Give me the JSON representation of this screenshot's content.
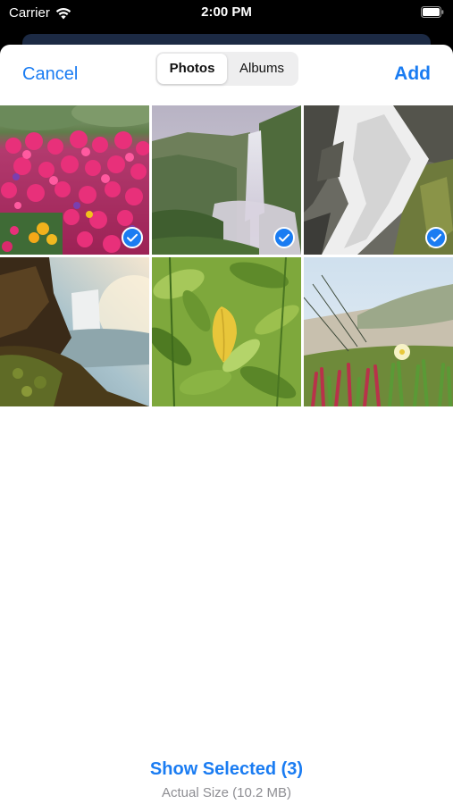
{
  "status_bar": {
    "carrier": "Carrier",
    "time": "2:00 PM"
  },
  "nav": {
    "cancel_label": "Cancel",
    "add_label": "Add",
    "tabs": [
      {
        "label": "Photos",
        "selected": true
      },
      {
        "label": "Albums",
        "selected": false
      }
    ]
  },
  "photos": [
    {
      "subject": "pink flowers",
      "selected": true
    },
    {
      "subject": "waterfall in green valley",
      "selected": true
    },
    {
      "subject": "long-exposure waterfall over rocks",
      "selected": true
    },
    {
      "subject": "waterfall and river at sunset",
      "selected": false
    },
    {
      "subject": "yellow leaf among green leaves",
      "selected": false
    },
    {
      "subject": "beach plants with white flower",
      "selected": false
    }
  ],
  "footer": {
    "show_selected_label": "Show Selected (3)",
    "actual_size_label": "Actual Size (10.2 MB)"
  },
  "colors": {
    "accent": "#1a7cf2",
    "check": "#1a7cf2",
    "secondary_text": "#8e8e93"
  },
  "icons": [
    "wifi-icon",
    "battery-icon",
    "checkmark-circle-icon"
  ]
}
